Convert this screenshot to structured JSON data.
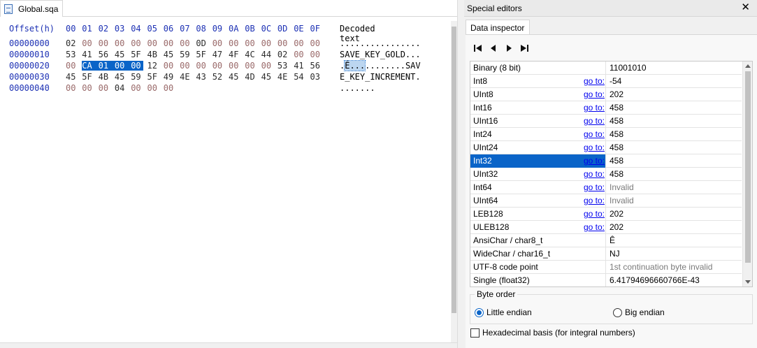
{
  "document_tab": {
    "label": "Global.sqa",
    "icon": "hex-file-icon"
  },
  "hex": {
    "header_offset": "Offset(h)",
    "header_columns": [
      "00",
      "01",
      "02",
      "03",
      "04",
      "05",
      "06",
      "07",
      "08",
      "09",
      "0A",
      "0B",
      "0C",
      "0D",
      "0E",
      "0F"
    ],
    "header_decoded": "Decoded text",
    "rows": [
      {
        "offset": "00000000",
        "bytes": [
          "02",
          "00",
          "00",
          "00",
          "00",
          "00",
          "00",
          "00",
          "0D",
          "00",
          "00",
          "00",
          "00",
          "00",
          "00",
          "00"
        ],
        "decoded": "................"
      },
      {
        "offset": "00000010",
        "bytes": [
          "53",
          "41",
          "56",
          "45",
          "5F",
          "4B",
          "45",
          "59",
          "5F",
          "47",
          "4F",
          "4C",
          "44",
          "02",
          "00",
          "00"
        ],
        "decoded": "SAVE_KEY_GOLD..."
      },
      {
        "offset": "00000020",
        "bytes": [
          "00",
          "CA",
          "01",
          "00",
          "00",
          "12",
          "00",
          "00",
          "00",
          "00",
          "00",
          "00",
          "00",
          "53",
          "41",
          "56"
        ],
        "decoded_pre": ".",
        "decoded_sel": "Ê...",
        "decoded_post": "........SAV"
      },
      {
        "offset": "00000030",
        "bytes": [
          "45",
          "5F",
          "4B",
          "45",
          "59",
          "5F",
          "49",
          "4E",
          "43",
          "52",
          "45",
          "4D",
          "45",
          "4E",
          "54",
          "03"
        ],
        "decoded": "E_KEY_INCREMENT."
      },
      {
        "offset": "00000040",
        "bytes": [
          "00",
          "00",
          "00",
          "04",
          "00",
          "00",
          "00"
        ],
        "decoded": "......."
      }
    ],
    "selection": {
      "row": 2,
      "start": 1,
      "end": 4
    }
  },
  "special_editors": {
    "title": "Special editors",
    "close_glyph": "✕",
    "tab": "Data inspector",
    "nav_icons": [
      "first-icon",
      "previous-icon",
      "next-icon",
      "last-icon"
    ],
    "rows": [
      {
        "name": "Binary (8 bit)",
        "goto": "",
        "value": "11001010",
        "dim": false
      },
      {
        "name": "Int8",
        "goto": "go to:",
        "value": "-54",
        "dim": false
      },
      {
        "name": "UInt8",
        "goto": "go to:",
        "value": "202",
        "dim": false
      },
      {
        "name": "Int16",
        "goto": "go to:",
        "value": "458",
        "dim": false
      },
      {
        "name": "UInt16",
        "goto": "go to:",
        "value": "458",
        "dim": false
      },
      {
        "name": "Int24",
        "goto": "go to:",
        "value": "458",
        "dim": false
      },
      {
        "name": "UInt24",
        "goto": "go to:",
        "value": "458",
        "dim": false
      },
      {
        "name": "Int32",
        "goto": "go to:",
        "value": "458",
        "dim": false
      },
      {
        "name": "UInt32",
        "goto": "go to:",
        "value": "458",
        "dim": false
      },
      {
        "name": "Int64",
        "goto": "go to:",
        "value": "Invalid",
        "dim": true
      },
      {
        "name": "UInt64",
        "goto": "go to:",
        "value": "Invalid",
        "dim": true
      },
      {
        "name": "LEB128",
        "goto": "go to:",
        "value": "202",
        "dim": false
      },
      {
        "name": "ULEB128",
        "goto": "go to:",
        "value": "202",
        "dim": false
      },
      {
        "name": "AnsiChar / char8_t",
        "goto": "",
        "value": "Ê",
        "dim": false
      },
      {
        "name": "WideChar / char16_t",
        "goto": "",
        "value": "NJ",
        "dim": false
      },
      {
        "name": "UTF-8 code point",
        "goto": "",
        "value": "1st continuation byte invalid",
        "dim": true
      },
      {
        "name": "Single (float32)",
        "goto": "",
        "value": "6.41794696660766E-43",
        "dim": false
      }
    ],
    "selected_row": 7,
    "byte_order": {
      "legend": "Byte order",
      "little": "Little endian",
      "big": "Big endian",
      "selected": "little"
    },
    "hex_basis_label": "Hexadecimal basis (for integral numbers)",
    "hex_basis_checked": false
  },
  "colors": {
    "selection": "#0a64c8",
    "offset_text": "#1d31b4",
    "zero_byte": "#9a6a6a",
    "link": "#0000ee"
  }
}
